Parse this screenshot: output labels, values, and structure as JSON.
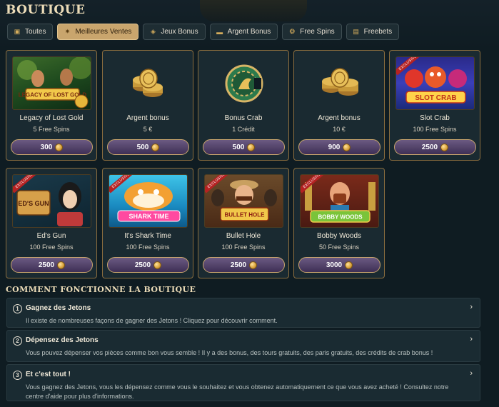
{
  "page": {
    "title": "BOUTIQUE"
  },
  "tabs": [
    {
      "label": "Toutes",
      "icon": "store-icon",
      "active": false
    },
    {
      "label": "Meilleures Ventes",
      "icon": "star-icon",
      "active": true
    },
    {
      "label": "Jeux Bonus",
      "icon": "gamepad-icon",
      "active": false
    },
    {
      "label": "Argent Bonus",
      "icon": "money-icon",
      "active": false
    },
    {
      "label": "Free Spins",
      "icon": "spin-icon",
      "active": false
    },
    {
      "label": "Freebets",
      "icon": "ticket-icon",
      "active": false
    }
  ],
  "products": [
    {
      "title": "Legacy of Lost Gold",
      "subtitle": "5 Free Spins",
      "price": "300",
      "image": "legacy-of-lost-gold-thumbnail",
      "art_text": "LEGACY OF LOST GOLD",
      "exclusive": false
    },
    {
      "title": "Argent bonus",
      "subtitle": "5 €",
      "price": "500",
      "image": "gold-coins-stack-icon",
      "art_text": "",
      "exclusive": false
    },
    {
      "title": "Bonus Crab",
      "subtitle": "1 Crédit",
      "price": "500",
      "image": "crab-chip-icon",
      "art_text": "",
      "exclusive": false
    },
    {
      "title": "Argent bonus",
      "subtitle": "10 €",
      "price": "900",
      "image": "gold-coins-stack-icon",
      "art_text": "",
      "exclusive": false
    },
    {
      "title": "Slot Crab",
      "subtitle": "100 Free Spins",
      "price": "2500",
      "image": "slot-crab-thumbnail",
      "art_text": "SLOT CRAB",
      "exclusive": true
    },
    {
      "title": "Ed's Gun",
      "subtitle": "100 Free Spins",
      "price": "2500",
      "image": "eds-gun-thumbnail",
      "art_text": "ED'S GUN",
      "exclusive": true
    },
    {
      "title": "It's Shark Time",
      "subtitle": "100 Free Spins",
      "price": "2500",
      "image": "shark-time-thumbnail",
      "art_text": "SHARK TIME",
      "exclusive": true
    },
    {
      "title": "Bullet Hole",
      "subtitle": "100 Free Spins",
      "price": "2500",
      "image": "bullet-hole-thumbnail",
      "art_text": "BULLET HOLE",
      "exclusive": true
    },
    {
      "title": "Bobby Woods",
      "subtitle": "50 Free Spins",
      "price": "3000",
      "image": "bobby-woods-thumbnail",
      "art_text": "BOBBY WOODS",
      "exclusive": true
    }
  ],
  "exclusive_label": "EXCLUSIVE",
  "how_it_works": {
    "title": "COMMENT FONCTIONNE LA BOUTIQUE",
    "items": [
      {
        "num": "1",
        "title": "Gagnez des Jetons",
        "text": "Il existe de nombreuses façons de gagner des Jetons ! Cliquez pour découvrir comment."
      },
      {
        "num": "2",
        "title": "Dépensez des Jetons",
        "text": "Vous pouvez dépenser vos pièces comme bon vous semble ! Il y a des bonus, des tours gratuits, des paris gratuits, des crédits de crab bonus !"
      },
      {
        "num": "3",
        "title": "Et c'est tout !",
        "text": "Vous gagnez des Jetons, vous les dépensez comme vous le souhaitez et vous obtenez automatiquement ce que vous avez acheté ! Consultez notre centre d'aide pour plus d'informations."
      }
    ]
  }
}
